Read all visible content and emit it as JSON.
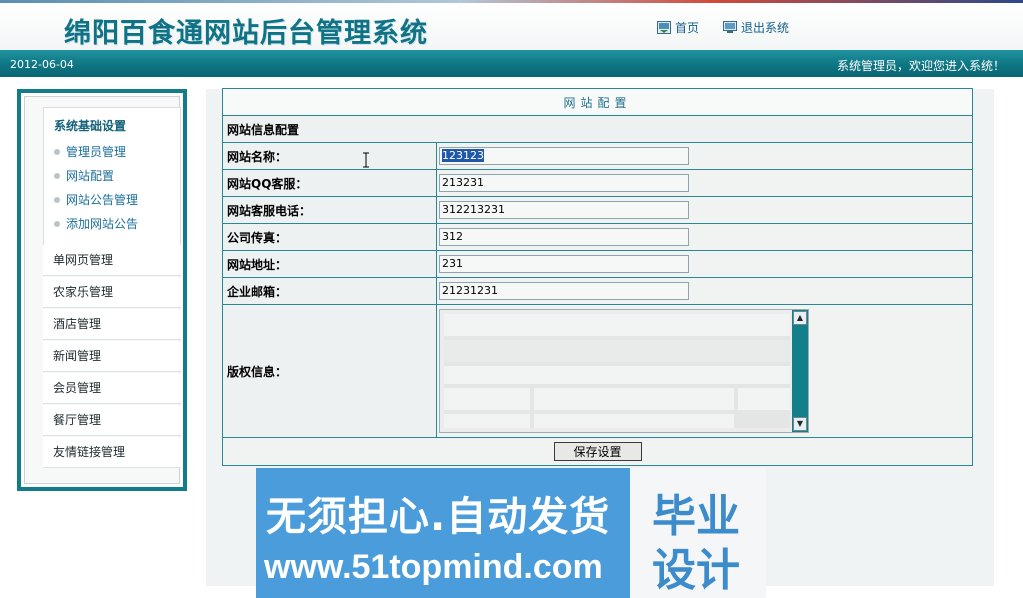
{
  "header": {
    "system_title": "绵阳百食通网站后台管理系统",
    "home_label": "首页",
    "logout_label": "退出系统"
  },
  "statusbar": {
    "date": "2012-06-04",
    "welcome": "系统管理员，欢迎您进入系统！"
  },
  "sidebar": {
    "section_title": "系统基础设置",
    "sub_items": [
      {
        "label": "管理员管理"
      },
      {
        "label": "网站配置"
      },
      {
        "label": "网站公告管理"
      },
      {
        "label": "添加网站公告"
      }
    ],
    "menu_items": [
      {
        "label": "单网页管理"
      },
      {
        "label": "农家乐管理"
      },
      {
        "label": "酒店管理"
      },
      {
        "label": "新闻管理"
      },
      {
        "label": "会员管理"
      },
      {
        "label": "餐厅管理"
      },
      {
        "label": "友情链接管理"
      }
    ]
  },
  "config": {
    "title": "网站配置",
    "section": "网站信息配置",
    "fields": [
      {
        "label": "网站名称：",
        "value": "123123",
        "selected": true
      },
      {
        "label": "网站QQ客服：",
        "value": "213231"
      },
      {
        "label": "网站客服电话：",
        "value": "312213231"
      },
      {
        "label": "公司传真：",
        "value": "312"
      },
      {
        "label": "网站地址：",
        "value": "231"
      },
      {
        "label": "企业邮箱：",
        "value": "21231231"
      }
    ],
    "copyright_label": "版权信息：",
    "save_label": "保存设置"
  },
  "watermark": {
    "line1": "无须担心.自动发货",
    "line2": "www.51topmind.com",
    "right_line1": "毕业",
    "right_line2": "设计"
  },
  "colors": {
    "accent": "#127c89",
    "title_text": "#0f7285",
    "link": "#1a6f9a",
    "watermark_blue": "#4a9cdb"
  }
}
